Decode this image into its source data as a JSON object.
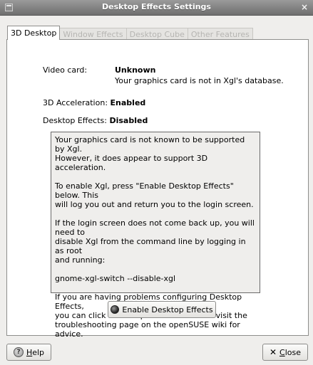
{
  "window": {
    "title": "Desktop Effects Settings",
    "close_glyph": "×"
  },
  "tabs": [
    {
      "label": "3D Desktop",
      "active": true
    },
    {
      "label": "Window Effects",
      "active": false
    },
    {
      "label": "Desktop Cube",
      "active": false
    },
    {
      "label": "Other Features",
      "active": false
    }
  ],
  "info": {
    "video_card_label": "Video card:",
    "video_card_value": "Unknown",
    "video_card_note": "Your graphics card is not in Xgl's database.",
    "acceleration_label": "3D Acceleration:",
    "acceleration_value": "Enabled",
    "effects_label": "Desktop Effects:",
    "effects_value": "Disabled"
  },
  "message": {
    "p1": "Your graphics card is not known to be supported by Xgl.\nHowever, it does appear to support 3D acceleration.",
    "p2": "To enable Xgl, press \"Enable Desktop Effects\" below. This\nwill log you out and return you to the login screen.",
    "p3": "If the login screen does not come back up, you will need to\ndisable Xgl from the command line by logging in as root\nand running:",
    "p4": "gnome-xgl-switch --disable-xgl",
    "p5": "If you are having problems configuring Desktop Effects,\nyou can click the \"Help\" button below to visit the\ntroubleshooting page on the openSUSE wiki for advice."
  },
  "buttons": {
    "enable_label": "Enable Desktop Effects",
    "help_prefix": "",
    "help_mnemonic": "H",
    "help_rest": "elp",
    "close_mnemonic": "C",
    "close_rest": "lose"
  },
  "icons": {
    "menu": "window-menu-icon",
    "enable": "effects-icon",
    "help": "help-icon",
    "close": "close-icon"
  }
}
